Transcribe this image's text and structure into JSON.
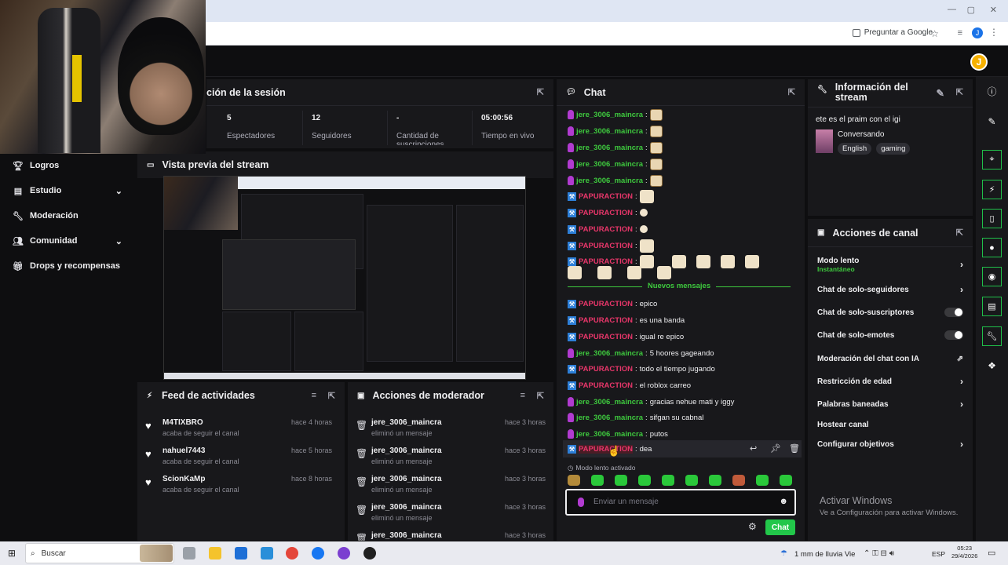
{
  "browser": {
    "window_controls": [
      "—",
      "▢",
      "✕"
    ],
    "ask_google": "Preguntar a Google",
    "profile_letter": "J"
  },
  "app": {
    "avatar_letter": "J"
  },
  "nav": {
    "items": [
      {
        "label": "Logros",
        "icon": "trophy-icon",
        "has_chevron": false
      },
      {
        "label": "Estudio",
        "icon": "grid-icon",
        "has_chevron": true
      },
      {
        "label": "Moderación",
        "icon": "wrench-icon",
        "has_chevron": false
      },
      {
        "label": "Comunidad",
        "icon": "people-icon",
        "has_chevron": true
      },
      {
        "label": "Drops y recompensas",
        "icon": "gift-icon",
        "has_chevron": false
      }
    ]
  },
  "session": {
    "title": "ción de la sesión",
    "stats": [
      {
        "value": "5",
        "label": "Espectadores"
      },
      {
        "value": "12",
        "label": "Seguidores"
      },
      {
        "value": "-",
        "label": "Cantidad de suscripciones"
      },
      {
        "value": "05:00:56",
        "label": "Tiempo en vivo"
      }
    ]
  },
  "preview": {
    "title": "Vista previa del stream"
  },
  "feed": {
    "title": "Feed de actividades",
    "items": [
      {
        "name": "M4TIXBRO",
        "action": "acaba de seguir el canal",
        "time": "hace 4 horas"
      },
      {
        "name": "nahuel7443",
        "action": "acaba de seguir el canal",
        "time": "hace 5 horas"
      },
      {
        "name": "ScionKaMp",
        "action": "acaba de seguir el canal",
        "time": "hace 8 horas"
      }
    ]
  },
  "mod_actions": {
    "title": "Acciones de moderador",
    "items": [
      {
        "name": "jere_3006_maincra",
        "action": "eliminó un mensaje",
        "time": "hace 3 horas"
      },
      {
        "name": "jere_3006_maincra",
        "action": "eliminó un mensaje",
        "time": "hace 3 horas"
      },
      {
        "name": "jere_3006_maincra",
        "action": "eliminó un mensaje",
        "time": "hace 3 horas"
      },
      {
        "name": "jere_3006_maincra",
        "action": "eliminó un mensaje",
        "time": "hace 3 horas"
      },
      {
        "name": "jere_3006_maincra",
        "action": "",
        "time": "hace 3 horas"
      }
    ]
  },
  "chat": {
    "title": "Chat",
    "messages_before": [
      {
        "user": "jere_3006_maincra",
        "style": "green",
        "text": ""
      },
      {
        "user": "jere_3006_maincra",
        "style": "green",
        "text": ""
      },
      {
        "user": "jere_3006_maincra",
        "style": "green",
        "text": ""
      },
      {
        "user": "jere_3006_maincra",
        "style": "green",
        "text": ""
      },
      {
        "user": "jere_3006_maincra",
        "style": "green",
        "text": ""
      },
      {
        "user": "PAPURACTION",
        "style": "red",
        "text": ""
      },
      {
        "user": "PAPURACTION",
        "style": "red",
        "text": ""
      },
      {
        "user": "PAPURACTION",
        "style": "red",
        "text": ""
      },
      {
        "user": "PAPURACTION",
        "style": "red",
        "text": ""
      },
      {
        "user": "PAPURACTION",
        "style": "red",
        "text": ""
      }
    ],
    "new_messages_label": "Nuevos mensajes",
    "messages_after": [
      {
        "user": "PAPURACTION",
        "style": "red",
        "text": "epico"
      },
      {
        "user": "PAPURACTION",
        "style": "red",
        "text": "es una banda"
      },
      {
        "user": "PAPURACTION",
        "style": "red",
        "text": "igual re epico"
      },
      {
        "user": "jere_3006_maincra",
        "style": "green",
        "text": "5 hoores gageando"
      },
      {
        "user": "PAPURACTION",
        "style": "red",
        "text": "todo el tiempo jugando"
      },
      {
        "user": "PAPURACTION",
        "style": "red",
        "text": "el roblox carreo"
      },
      {
        "user": "jere_3006_maincra",
        "style": "green",
        "text": "gracias nehue mati y iggy"
      },
      {
        "user": "jere_3006_maincra",
        "style": "green",
        "text": "sifgan su cabnal"
      },
      {
        "user": "jere_3006_maincra",
        "style": "green",
        "text": "putos"
      },
      {
        "user": "PAPURACTION",
        "style": "red-hi",
        "text": "dea"
      }
    ],
    "slow_mode": "Modo lento activado",
    "input_placeholder": "Enviar un mensaje",
    "send_label": "Chat"
  },
  "stream_info": {
    "title": "Información del stream",
    "stream_title": "ete es el praim con el igi",
    "category": "Conversando",
    "tags": [
      "English",
      "gaming"
    ]
  },
  "channel_actions": {
    "title": "Acciones de canal",
    "slow_mode_label": "Modo lento",
    "slow_mode_value": "Instantáneo",
    "items": [
      {
        "label": "Chat de solo-seguidores",
        "control": "arrow"
      },
      {
        "label": "Chat de solo-suscriptores",
        "control": "toggle"
      },
      {
        "label": "Chat de solo-emotes",
        "control": "toggle"
      },
      {
        "label": "Moderación del chat con IA",
        "control": "external"
      },
      {
        "label": "Restricción de edad",
        "control": "arrow"
      },
      {
        "label": "Palabras baneadas",
        "control": "arrow"
      },
      {
        "label": "Hostear canal",
        "control": "none"
      },
      {
        "label": "Configurar objetivos",
        "control": "arrow"
      }
    ]
  },
  "windows_watermark": {
    "line1": "Activar Windows",
    "line2": "Ve a Configuración para activar Windows."
  },
  "taskbar": {
    "search_placeholder": "Buscar",
    "weather": "1 mm de lluvia Vie",
    "language": "ESP",
    "time": "05:23",
    "date": "29/4/2026"
  },
  "colors": {
    "accent_green": "#22c74a",
    "panel_bg": "#18181b",
    "page_bg": "#0e0e10",
    "user_green": "#3ec93e",
    "user_red": "#e8366a"
  }
}
